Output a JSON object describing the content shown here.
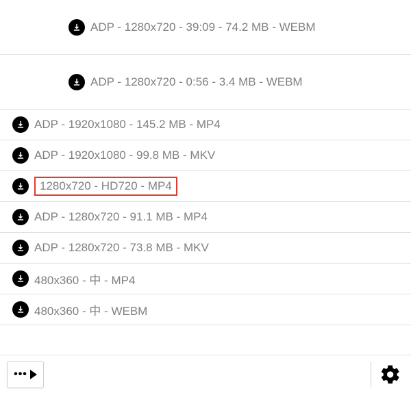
{
  "items": [
    {
      "label": "ADP - 1280x720 - 39:09 - 74.2 MB - WEBM",
      "tall": true,
      "highlight": false
    },
    {
      "label": "ADP - 1280x720 - 0:56 - 3.4 MB - WEBM",
      "tall": true,
      "highlight": false
    },
    {
      "label": "ADP - 1920x1080 - 145.2 MB - MP4",
      "tall": false,
      "highlight": false
    },
    {
      "label": "ADP - 1920x1080 - 99.8 MB - MKV",
      "tall": false,
      "highlight": false
    },
    {
      "label": "1280x720 - HD720 - MP4",
      "tall": false,
      "highlight": true
    },
    {
      "label": "ADP - 1280x720 - 91.1 MB - MP4",
      "tall": false,
      "highlight": false
    },
    {
      "label": "ADP - 1280x720 - 73.8 MB - MKV",
      "tall": false,
      "highlight": false
    },
    {
      "label": "480x360 - 中 - MP4",
      "tall": false,
      "highlight": false
    },
    {
      "label": "480x360 - 中 - WEBM",
      "tall": false,
      "highlight": false
    }
  ],
  "footer": {
    "settings": "settings"
  }
}
